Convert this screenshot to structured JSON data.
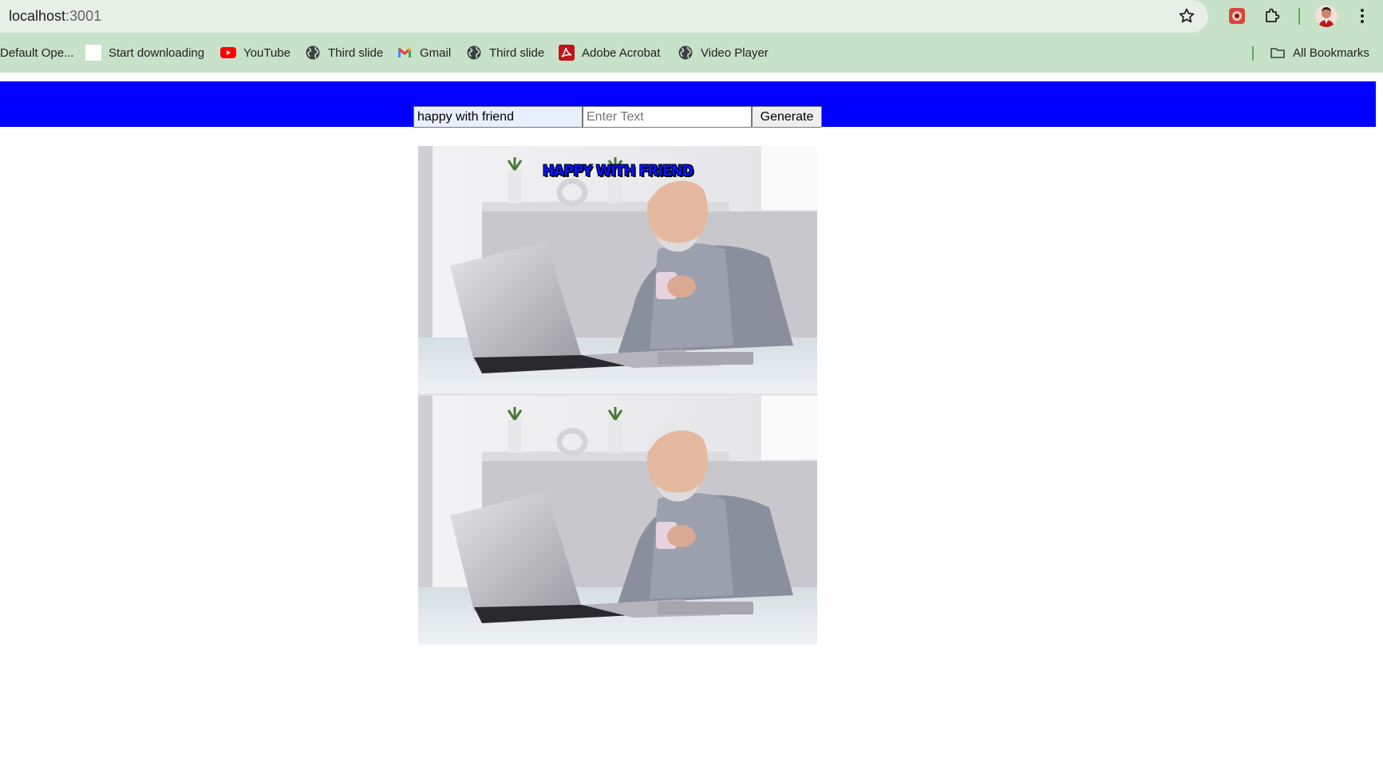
{
  "browser": {
    "url_host": "localhost",
    "url_port": ":3001",
    "bookmarks": [
      {
        "label": "Default Ope...",
        "icon": "none"
      },
      {
        "label": "Start downloading",
        "icon": "blank-page-icon"
      },
      {
        "label": "YouTube",
        "icon": "youtube-icon"
      },
      {
        "label": "Third slide",
        "icon": "globe-icon"
      },
      {
        "label": "Gmail",
        "icon": "gmail-icon"
      },
      {
        "label": "Third slide",
        "icon": "globe-icon"
      },
      {
        "label": "Adobe Acrobat",
        "icon": "acrobat-icon"
      },
      {
        "label": "Video Player",
        "icon": "globe-icon"
      }
    ],
    "all_bookmarks_label": "All Bookmarks"
  },
  "app": {
    "top_text_value": "happy with friend",
    "bottom_text_placeholder": "Enter Text",
    "generate_label": "Generate",
    "meme_caption": "HAPPY WITH FRIEND",
    "header_color": "#0000ff"
  }
}
